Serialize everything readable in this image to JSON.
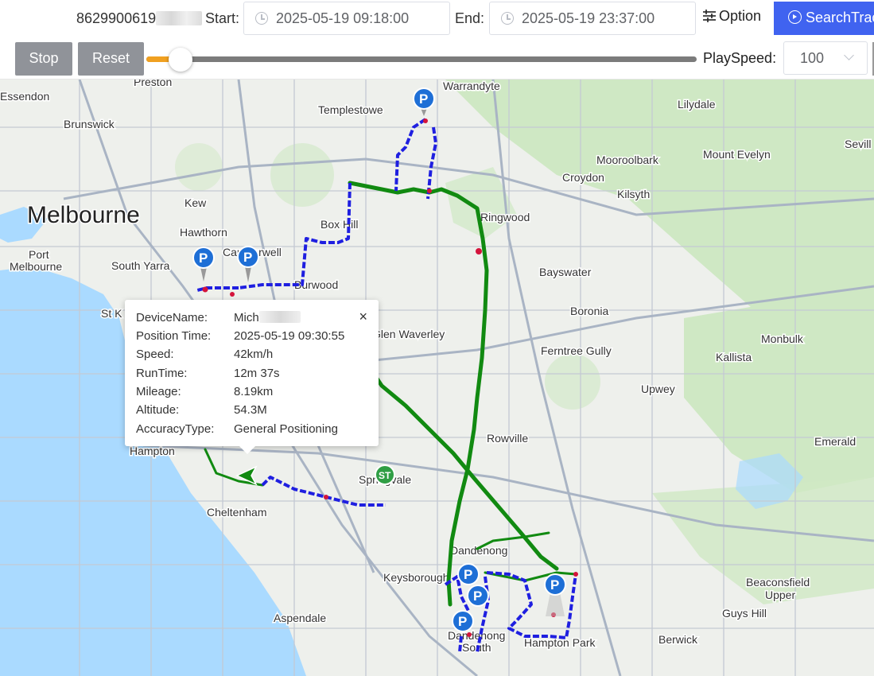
{
  "toolbar": {
    "device_id": "8629900619",
    "start_label": "Start:",
    "start_value": "2025-05-19 09:18:00",
    "end_label": "End:",
    "end_value": "2025-05-19 23:37:00",
    "option_label": "Option",
    "search_label": "SearchTrack",
    "stop_label": "Stop",
    "reset_label": "Reset",
    "progress_percent": 6,
    "playspeed_label": "PlaySpeed:",
    "playspeed_value": "100",
    "accent_color": "#4063f0",
    "progress_color": "#f0a020"
  },
  "popup": {
    "close_glyph": "×",
    "rows": [
      {
        "key": "DeviceName:",
        "value": "Mich"
      },
      {
        "key": "Position Time:",
        "value": "2025-05-19 09:30:55"
      },
      {
        "key": "Speed:",
        "value": "42km/h"
      },
      {
        "key": "RunTime:",
        "value": "12m 37s"
      },
      {
        "key": "Mileage:",
        "value": "8.19km"
      },
      {
        "key": "Altitude:",
        "value": "54.3M"
      },
      {
        "key": "AccuracyType:",
        "value": "General Positioning"
      }
    ]
  },
  "map": {
    "track_colors": {
      "slow": "#1f1fe0",
      "fast": "#118a11",
      "stop": "#d4143c"
    },
    "parking_marker_label": "P",
    "places": {
      "melbourne": "Melbourne",
      "preston": "Preston",
      "essendon": "Essendon",
      "brunswick": "Brunswick",
      "templestowe": "Templestowe",
      "warrandyte": "Warrandyte",
      "lilydale": "Lilydale",
      "mooroolbark": "Mooroolbark",
      "mount_evelyn": "Mount Evelyn",
      "croydon": "Croydon",
      "kilsyth": "Kilsyth",
      "kew": "Kew",
      "box_hill": "Box Hill",
      "ringwood": "Ringwood",
      "hawthorn": "Hawthorn",
      "camberwell": "Camberwell",
      "port_melbourne": "Port\nMelbourne",
      "south_yarra": "South Yarra",
      "burwood": "Burwood",
      "bayswater": "Bayswater",
      "boronia": "Boronia",
      "glen_waverley": "Glen Waverley",
      "ferntree_gully": "Ferntree Gully",
      "monbulk": "Monbulk",
      "kallista": "Kallista",
      "upwey": "Upwey",
      "rowville": "Rowville",
      "emerald": "Emerald",
      "hampton": "Hampton",
      "springvale": "Springvale",
      "cheltenham": "Cheltenham",
      "dandenong": "Dandenong",
      "keysborough": "Keysborough",
      "dandenong_south": "Dandenong\nSouth",
      "hampton_park": "Hampton Park",
      "beaconsfield_upper": "Beaconsfield\nUpper",
      "guys_hill": "Guys Hill",
      "berwick": "Berwick",
      "aspendale": "Aspendale",
      "seville": "Sevill",
      "st_kilda": "St K"
    }
  }
}
